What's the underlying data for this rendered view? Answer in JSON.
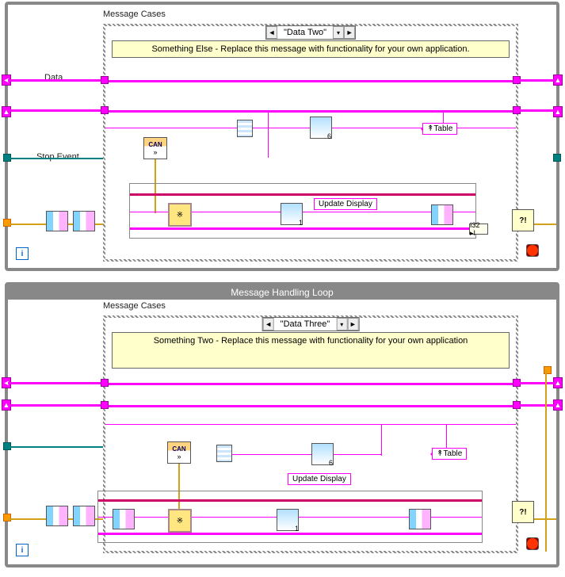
{
  "panel1": {
    "case_label": "Message Cases",
    "case_value": "\"Data Two\"",
    "comment": "Something Else - Replace this message with functionality for your own application.",
    "wire_data": "Data",
    "wire_stop": "Stop Event",
    "tag_update": "Update Display",
    "tag_table": "↟Table",
    "node_can": "CAN",
    "iter": "i",
    "vi_num_6": "6",
    "vi_num_1": "1",
    "coerce": "I32 ▸I"
  },
  "panel2": {
    "loop_title": "Message Handling Loop",
    "case_label": "Message Cases",
    "case_value": "\"Data Three\"",
    "comment": "Something Two - Replace this message with functionality for your own application",
    "tag_update": "Update Display",
    "tag_table": "↟Table",
    "node_can": "CAN",
    "iter": "i",
    "vi_num_6": "6",
    "vi_num_1": "1"
  }
}
